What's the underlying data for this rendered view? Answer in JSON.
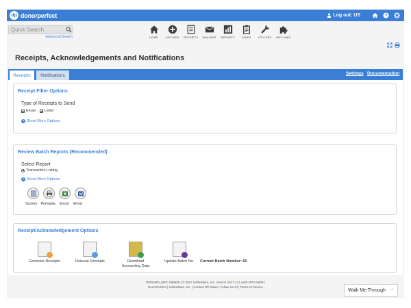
{
  "topbar": {
    "logo_badge": "dp",
    "logo_text": "donorperfect",
    "logout_label": "Log out: US"
  },
  "search": {
    "placeholder": "Quick Search",
    "advanced_link": "Advanced Search"
  },
  "nav": {
    "items": [
      {
        "label": "HOME",
        "icon": "home-icon"
      },
      {
        "label": "ADD NEW",
        "icon": "plus-circle-icon"
      },
      {
        "label": "RECEIPTS",
        "icon": "receipts-icon"
      },
      {
        "label": "MAILINGS",
        "icon": "envelope-icon"
      },
      {
        "label": "REPORTS",
        "icon": "bar-chart-icon"
      },
      {
        "label": "TASKS",
        "icon": "clipboard-icon"
      },
      {
        "label": "UTILITIES",
        "icon": "wrench-icon"
      },
      {
        "label": "APP LINKS",
        "icon": "puzzle-icon"
      }
    ]
  },
  "page": {
    "title": "Receipts, Acknowledgements and Notifications"
  },
  "tabs": {
    "receipts": "Receipts",
    "notifications": "Notifications",
    "settings": "Settings",
    "documentation": "Documentation"
  },
  "filter": {
    "title": "Receipt Filter Options",
    "type_label": "Type of Receipts to Send",
    "email_label": "Email",
    "letter_label": "Letter",
    "show_more": "Show More Options"
  },
  "batch": {
    "title": "Review Batch Reports (Recommended)",
    "select_label": "Select Report",
    "radio_label": "Transaction Listing",
    "show_more": "Show More Options",
    "formats": [
      "Screen",
      "Printable",
      "Excel",
      "Word"
    ]
  },
  "ack": {
    "title": "Receipt/Acknowledgement Options",
    "items": [
      "Generate Receipts",
      "Reissue Receipts",
      "Download",
      "Accounting Data",
      "Update Batch No."
    ],
    "batch_label": "Current Batch Number: 69"
  },
  "footer": {
    "line1": "DPDEMO_MKT, E99999 | © 2017 SofterWare, Inc. Version 2017.13 | AWS-DPO-WEB1",
    "line2_a": "DonorPerfect | SofterWare, Inc. | Contact DP Sales | Follow Us",
    "line2_b": "| Terms of Service"
  },
  "walkme": {
    "label": "Walk Me Through"
  },
  "colors": {
    "accent": "#3a7fd5",
    "page_bg": "#f4f4f4"
  }
}
